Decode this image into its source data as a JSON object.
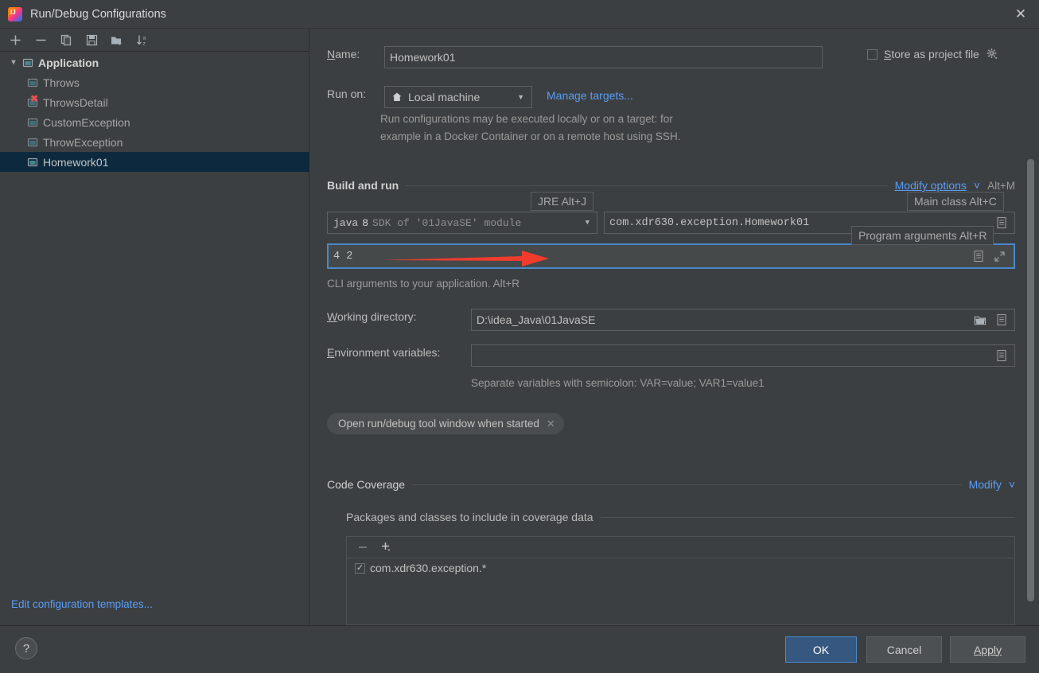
{
  "window": {
    "title": "Run/Debug Configurations",
    "app_icon": "intellij-idea-icon",
    "close_icon": "close-icon"
  },
  "sidebar": {
    "toolbar": [
      {
        "name": "add-configuration-button",
        "icon": "plus-icon",
        "label": "+"
      },
      {
        "name": "remove-configuration-button",
        "icon": "minus-icon",
        "label": "−"
      },
      {
        "name": "copy-configuration-button",
        "icon": "copy-icon",
        "label": "Copy"
      },
      {
        "name": "save-configuration-button",
        "icon": "save-icon",
        "label": "Save"
      },
      {
        "name": "new-folder-button",
        "icon": "new-folder-icon",
        "label": "New Folder"
      },
      {
        "name": "sort-configurations-button",
        "icon": "sort-alpha-icon",
        "label": "Sort"
      }
    ],
    "group": {
      "label": "Application",
      "icon": "application-icon",
      "expanded": true
    },
    "items": [
      {
        "label": "Throws",
        "icon": "application-icon",
        "error": false,
        "selected": false
      },
      {
        "label": "ThrowsDetail",
        "icon": "application-icon",
        "error": true,
        "selected": false
      },
      {
        "label": "CustomException",
        "icon": "application-icon",
        "error": false,
        "selected": false
      },
      {
        "label": "ThrowException",
        "icon": "application-icon",
        "error": false,
        "selected": false
      },
      {
        "label": "Homework01",
        "icon": "application-icon",
        "error": false,
        "selected": true
      }
    ],
    "edit_templates": "Edit configuration templates..."
  },
  "form": {
    "name_label": "Name:",
    "name_value": "Homework01",
    "store_as_project_file_label": "Store as project file",
    "store_as_project_file_checked": false,
    "store_gear_icon": "gear-icon",
    "run_on_label": "Run on:",
    "run_on_value": "Local machine",
    "run_on_icon": "home-icon",
    "manage_targets_link": "Manage targets...",
    "run_on_description_line1": "Run configurations may be executed locally or on a target: for",
    "run_on_description_line2": "example in a Docker Container or on a remote host using SSH."
  },
  "build_and_run": {
    "section_title": "Build and run",
    "modify_options_link": "Modify options",
    "modify_options_shortcut": "Alt+M",
    "modify_options_caret": "chevron-down-icon",
    "jre_value_prefix": "java",
    "jre_value_version": "8",
    "jre_value_suffix": "SDK of '01JavaSE' module",
    "main_class_value": "com.xdr630.exception.Homework01",
    "main_class_browse_icon": "expand-icon",
    "program_arguments_value": "4 2",
    "program_arguments_macro_icon": "macro-icon",
    "program_arguments_expand_icon": "expand-editor-icon",
    "cli_hint": "CLI arguments to your application. Alt+R",
    "tooltips": [
      {
        "name": "jre-tooltip",
        "text": "JRE Alt+J"
      },
      {
        "name": "main-class-tooltip",
        "text": "Main class Alt+C"
      },
      {
        "name": "program-arguments-tooltip",
        "text": "Program arguments Alt+R"
      }
    ],
    "annotation_arrow_color": "#f03b2d"
  },
  "directories": {
    "working_directory_label": "Working directory:",
    "working_directory_value": "D:\\idea_Java\\01JavaSE",
    "working_directory_browse_icon": "folder-icon",
    "working_directory_macro_icon": "macro-icon",
    "environment_variables_label": "Environment variables:",
    "environment_variables_value": "",
    "environment_variables_macro_icon": "macro-icon",
    "environment_hint": "Separate variables with semicolon: VAR=value; VAR1=value1"
  },
  "options_chip": {
    "label": "Open run/debug tool window when started",
    "remove_icon": "close-icon"
  },
  "code_coverage": {
    "section_title": "Code Coverage",
    "modify_link": "Modify",
    "modify_caret": "chevron-down-icon",
    "subsection_title": "Packages and classes to include in coverage data",
    "toolbar": [
      {
        "name": "remove-package-button",
        "icon": "minus-icon",
        "label": "−"
      },
      {
        "name": "add-package-button",
        "icon": "plus-dropdown-icon",
        "label": "+"
      }
    ],
    "entries": [
      {
        "label": "com.xdr630.exception.*",
        "checked": true
      }
    ]
  },
  "footer": {
    "help_label": "?",
    "ok_label": "OK",
    "cancel_label": "Cancel",
    "apply_label": "Apply"
  },
  "colors": {
    "background": "#3c3f41",
    "selection": "#0d293e",
    "link": "#589df6",
    "primary_button": "#365880",
    "focus_border": "#4a88c7",
    "error": "#e05252",
    "annotation_red": "#f03b2d"
  }
}
